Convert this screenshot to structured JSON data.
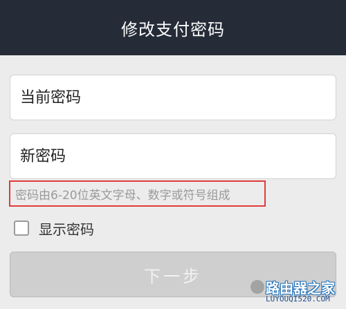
{
  "header": {
    "title": "修改支付密码"
  },
  "form": {
    "current_password_placeholder": "当前密码",
    "new_password_placeholder": "新密码",
    "hint": "密码由6-20位英文字母、数字或符号组成",
    "show_password_label": "显示密码",
    "show_password_checked": false,
    "next_button_label": "下一步"
  },
  "watermark": {
    "title": "路由器之家",
    "url": "LUYOUQI520.COM"
  },
  "colors": {
    "header_bg": "#262b38",
    "page_bg": "#ececec",
    "hint_border": "#e23a3a",
    "button_disabled_bg": "#cfcfcf"
  },
  "icons": {
    "checkbox": "checkbox-unchecked-icon"
  }
}
